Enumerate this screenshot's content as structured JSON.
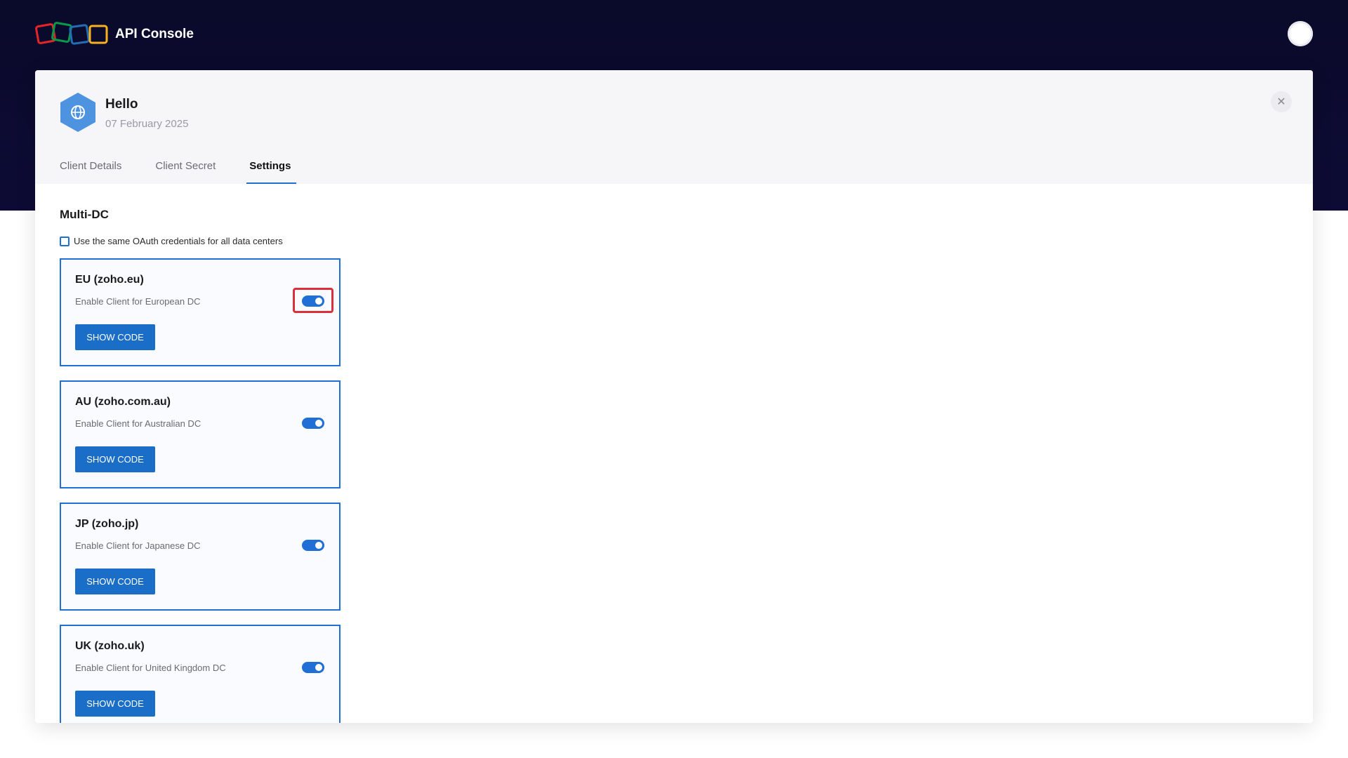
{
  "header": {
    "app_title": "API Console",
    "logo_icon": "zoho-logo-icon",
    "avatar_icon": "user-avatar"
  },
  "client": {
    "name": "Hello",
    "date": "07 February 2025",
    "icon": "globe-hexagon-icon"
  },
  "tabs": [
    {
      "label": "Client Details",
      "active": false
    },
    {
      "label": "Client Secret",
      "active": false
    },
    {
      "label": "Settings",
      "active": true
    }
  ],
  "settings": {
    "section_title": "Multi-DC",
    "same_credentials_label": "Use the same OAuth credentials for all data centers",
    "same_credentials_checked": false
  },
  "data_centers": [
    {
      "title": "EU (zoho.eu)",
      "description": "Enable Client for European DC",
      "enabled": true,
      "button_label": "SHOW CODE",
      "highlighted": true
    },
    {
      "title": "AU (zoho.com.au)",
      "description": "Enable Client for Australian DC",
      "enabled": true,
      "button_label": "SHOW CODE",
      "highlighted": false
    },
    {
      "title": "JP (zoho.jp)",
      "description": "Enable Client for Japanese DC",
      "enabled": true,
      "button_label": "SHOW CODE",
      "highlighted": false
    },
    {
      "title": "UK (zoho.uk)",
      "description": "Enable Client for United Kingdom DC",
      "enabled": true,
      "button_label": "SHOW CODE",
      "highlighted": false
    }
  ],
  "colors": {
    "header_bg": "#0a0a2a",
    "accent": "#1f6fd6",
    "button_bg": "#1a6ec8",
    "highlight": "#d9303c"
  }
}
